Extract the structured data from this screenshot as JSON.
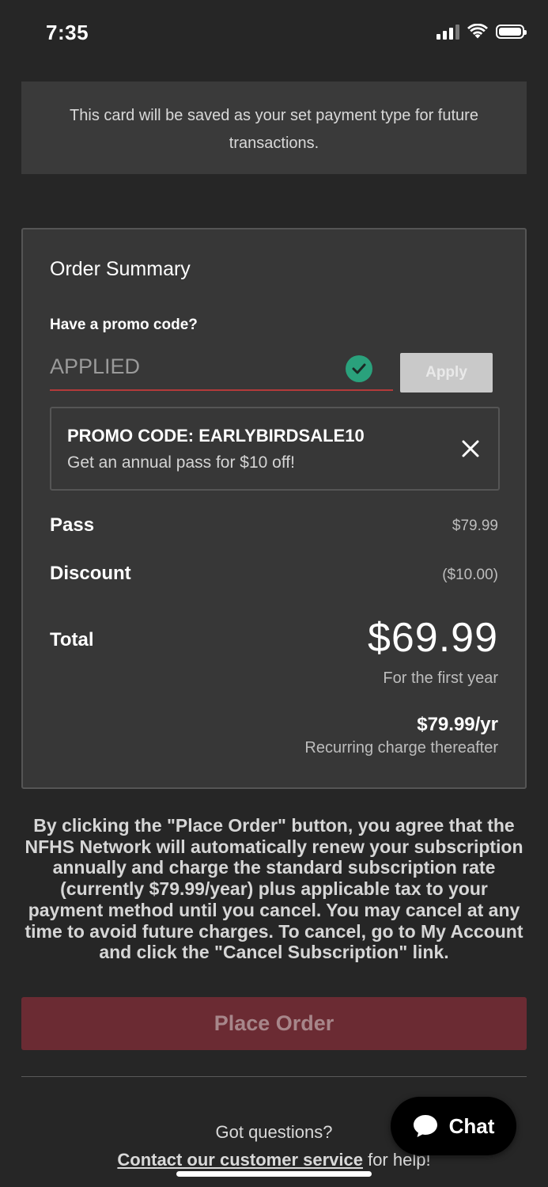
{
  "status_bar": {
    "time": "7:35",
    "icons": [
      "signal-icon",
      "wifi-icon",
      "battery-icon"
    ]
  },
  "banner": {
    "text": "This card will be saved as your set payment type for future transactions."
  },
  "summary": {
    "title": "Order Summary",
    "promo_label": "Have a promo code?",
    "promo_input_value": "APPLIED",
    "apply_label": "Apply",
    "promo_code_title": "PROMO CODE: EARLYBIRDSALE10",
    "promo_code_desc": "Get an annual pass for $10 off!",
    "pass_label": "Pass",
    "pass_value": "$79.99",
    "discount_label": "Discount",
    "discount_value": "($10.00)",
    "total_label": "Total",
    "total_value": "$69.99",
    "total_note": "For the first year",
    "recurring_price": "$79.99/yr",
    "recurring_note": "Recurring charge thereafter"
  },
  "disclaimer": "By clicking the \"Place Order\" button, you agree that the NFHS Network will automatically renew your subscription annually and charge the standard subscription rate (currently $79.99/year) plus applicable tax to your payment method until you cancel. You may cancel at any time to avoid future charges. To cancel, go to My Account and click the \"Cancel Subscription\" link.",
  "place_order_label": "Place Order",
  "footer": {
    "questions": "Got questions?",
    "contact_link": "Contact our customer service",
    "help_suffix": " for help!"
  },
  "chat": {
    "label": "Chat"
  },
  "colors": {
    "background": "#262626",
    "accent_red": "#b33a3a",
    "place_order_bg": "#6b2b33",
    "check_green": "#2aa17c"
  }
}
